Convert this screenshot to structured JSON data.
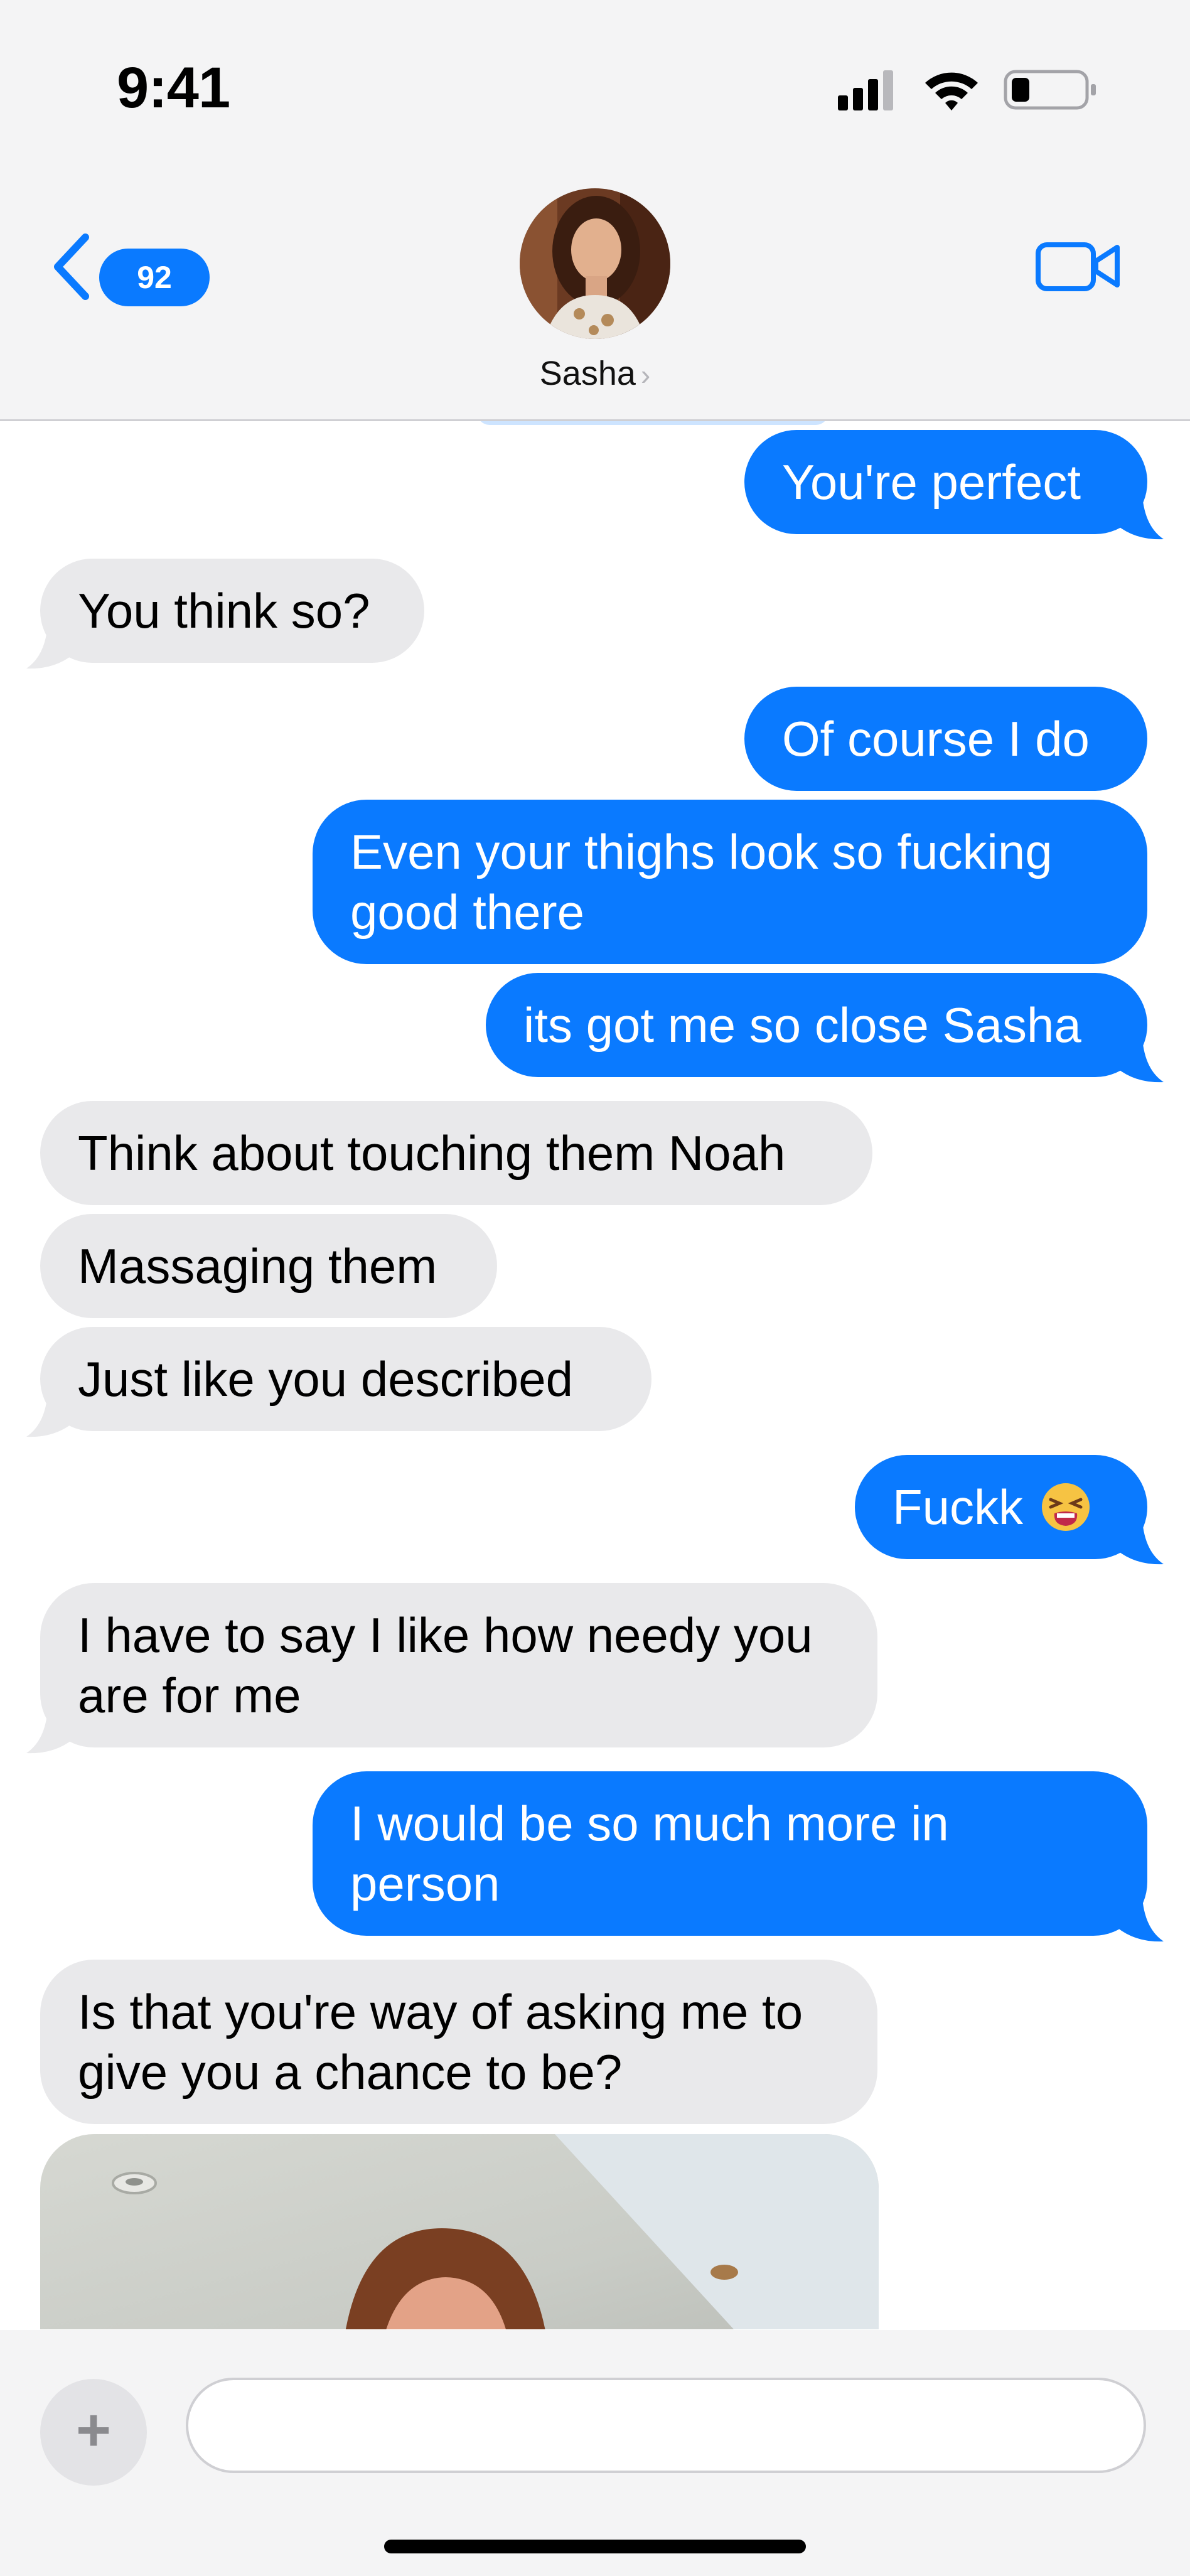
{
  "status_bar": {
    "time": "9:41"
  },
  "header": {
    "back_badge": "92",
    "contact_name": "Sasha",
    "name_chevron": "›",
    "icons": {
      "back": "chevron-left-icon",
      "video": "video-camera-icon",
      "signal": "cellular-signal-icon",
      "wifi": "wifi-icon",
      "battery": "battery-icon"
    }
  },
  "messages": [
    {
      "direction": "outgoing",
      "text": "You're perfect"
    },
    {
      "direction": "incoming",
      "text": "You think so?"
    },
    {
      "direction": "outgoing",
      "text": "Of course I do"
    },
    {
      "direction": "outgoing",
      "text": "Even your thighs look so fucking good there"
    },
    {
      "direction": "outgoing",
      "text": "its got me so close Sasha"
    },
    {
      "direction": "incoming",
      "text": "Think about touching them Noah"
    },
    {
      "direction": "incoming",
      "text": "Massaging them"
    },
    {
      "direction": "incoming",
      "text": "Just like you described"
    },
    {
      "direction": "outgoing",
      "text": "Fuckk",
      "emoji": "😫"
    },
    {
      "direction": "incoming",
      "text": "I have to say I like how needy you are for me"
    },
    {
      "direction": "outgoing",
      "text": "I would be so much more in person"
    },
    {
      "direction": "incoming",
      "text": "Is that you're way of asking me to give you a chance to be?"
    },
    {
      "direction": "incoming",
      "type": "photo"
    }
  ],
  "input_bar": {
    "placeholder": "",
    "icons": {
      "plus": "plus-icon",
      "mic": "microphone-icon"
    }
  },
  "colors": {
    "outgoing_bubble": "#0a7aff",
    "incoming_bubble": "#e9e9eb",
    "header_bg": "#f4f4f5"
  }
}
